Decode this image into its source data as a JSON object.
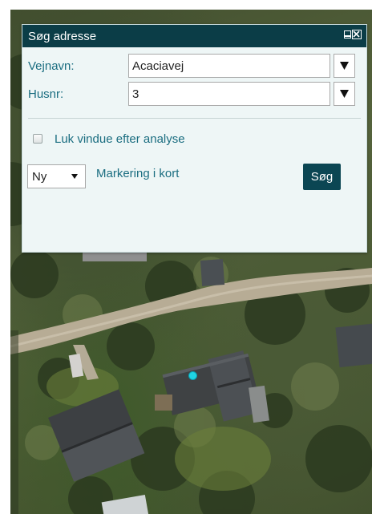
{
  "dialog": {
    "title": "Søg adresse",
    "fields": [
      {
        "label": "Vejnavn:",
        "value": "Acaciavej"
      },
      {
        "label": "Husnr:",
        "value": "3"
      }
    ],
    "close_after_analysis_label": "Luk vindue efter analyse",
    "close_after_analysis_checked": false,
    "mode_select_value": "Ny",
    "marking_link": "Markering i kort",
    "search_button": "Søg"
  },
  "colors": {
    "header": "#0b3d47",
    "label_text": "#1a6d80",
    "button": "#0b4653",
    "marker": "#1fd4e4"
  }
}
